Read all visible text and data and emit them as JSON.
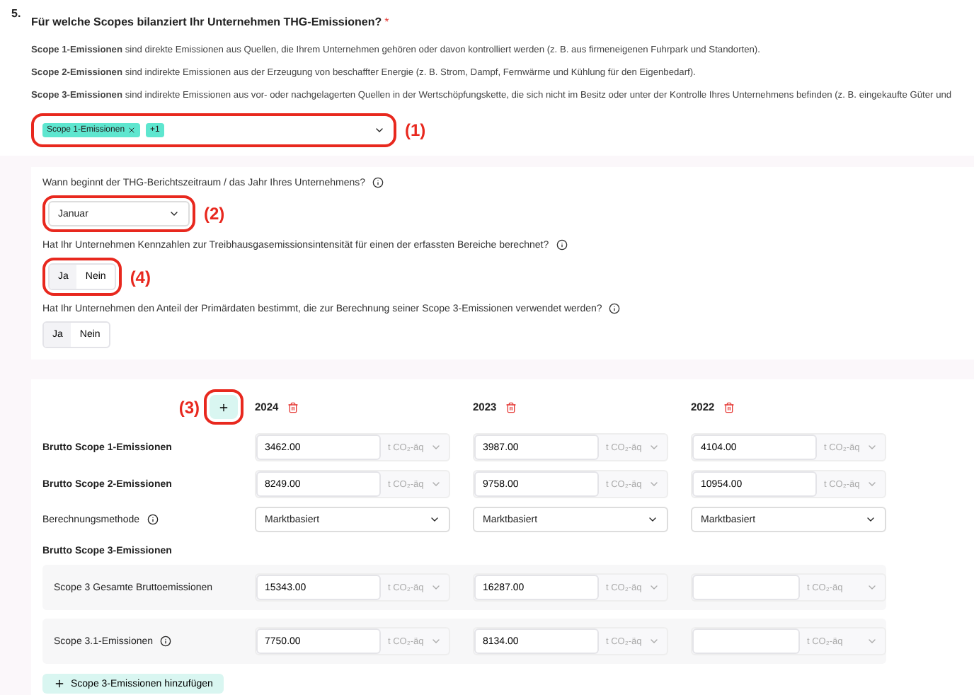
{
  "question": {
    "number": "5.",
    "title": "Für welche Scopes bilanziert Ihr Unternehmen THG-Emissionen?",
    "required_mark": "*"
  },
  "descriptions": [
    "**Scope 1-Emissionen** sind direkte Emissionen aus Quellen, die Ihrem Unternehmen gehören oder davon kontrolliert werden (z. B. aus firmeneigenen Fuhrpark und Standorten).",
    "**Scope 2-Emissionen** sind indirekte Emissionen aus der Erzeugung von beschaffter Energie (z. B. Strom, Dampf, Fernwärme und Kühlung für den Eigenbedarf).",
    "**Scope 3-Emissionen** sind indirekte Emissionen aus vor- oder nachgelagerten Quellen in der Wertschöpfungskette, die sich nicht im Besitz oder unter der Kontrolle Ihres Unternehmens befinden (z. B. eingekaufte Güter und"
  ],
  "scope_select": {
    "annotation": "(1)",
    "tags": [
      {
        "label": "Scope 1-Emissionen",
        "removable": true
      },
      {
        "label": "+1",
        "removable": false
      }
    ]
  },
  "questions": [
    {
      "kind": "select",
      "label": "Wann beginnt der THG-Berichtszeitraum / das Jahr Ihres Unternehmens?",
      "value": "Januar",
      "annotation": "(2)"
    },
    {
      "kind": "toggle",
      "label": "Hat Ihr Unternehmen Kennzahlen zur Treibhausgasemissionsintensität für einen der erfassten Bereiche berechnet?",
      "annotation": "(4)",
      "options": [
        {
          "label": "Ja",
          "selected": false
        },
        {
          "label": "Nein",
          "selected": false
        }
      ]
    },
    {
      "kind": "toggle",
      "label": "Hat Ihr Unternehmen den Anteil der Primärdaten bestimmt, die zur Berechnung seiner Scope 3-Emissionen verwendet werden?",
      "options": [
        {
          "label": "Ja",
          "selected": false
        },
        {
          "label": "Nein",
          "selected": false
        }
      ]
    }
  ],
  "table": {
    "add_year_annotation": "(3)",
    "years": [
      "2024",
      "2023",
      "2022"
    ],
    "rows": [
      {
        "kind": "value",
        "label": "Brutto Scope 1-Emissionen",
        "cells": [
          {
            "value": "3462.00",
            "unit": "t CO₂-äq"
          },
          {
            "value": "3987.00",
            "unit": "t CO₂-äq"
          },
          {
            "value": "4104.00",
            "unit": "t CO₂-äq"
          }
        ]
      },
      {
        "kind": "value",
        "label": "Brutto Scope 2-Emissionen",
        "cells": [
          {
            "value": "8249.00",
            "unit": "t CO₂-äq"
          },
          {
            "value": "9758.00",
            "unit": "t CO₂-äq"
          },
          {
            "value": "10954.00",
            "unit": "t CO₂-äq"
          }
        ]
      },
      {
        "kind": "select",
        "label": "Berechnungsmethode",
        "info": true,
        "cells": [
          {
            "value": "Marktbasiert"
          },
          {
            "value": "Marktbasiert"
          },
          {
            "value": "Marktbasiert"
          }
        ]
      },
      {
        "kind": "heading",
        "label": "Brutto Scope 3-Emissionen"
      },
      {
        "kind": "sub",
        "label": "Scope 3 Gesamte Bruttoemissionen",
        "cells": [
          {
            "value": "15343.00",
            "unit": "t CO₂-äq"
          },
          {
            "value": "16287.00",
            "unit": "t CO₂-äq"
          },
          {
            "unit": "t CO₂-äq"
          }
        ]
      },
      {
        "kind": "sub",
        "label": "Scope 3.1-Emissionen",
        "info": true,
        "cells": [
          {
            "value": "7750.00",
            "unit": "t CO₂-äq"
          },
          {
            "value": "8134.00",
            "unit": "t CO₂-äq"
          },
          {
            "unit": "t CO₂-äq"
          }
        ]
      }
    ],
    "add_scope3": "Scope 3-Emissionen hinzufügen"
  }
}
